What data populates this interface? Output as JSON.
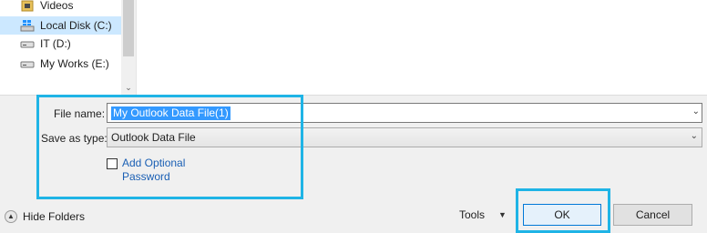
{
  "nav_tree": {
    "items": [
      {
        "label": "Videos",
        "icon": "videos-folder-icon"
      },
      {
        "label": "Local Disk (C:)",
        "icon": "windows-drive-icon"
      },
      {
        "label": "IT (D:)",
        "icon": "drive-icon"
      },
      {
        "label": "My Works (E:)",
        "icon": "drive-icon"
      }
    ],
    "selected_index": 1
  },
  "form": {
    "file_name_label": "File name:",
    "file_name_value": "My Outlook Data File(1)",
    "save_as_type_label": "Save as type:",
    "save_as_type_value": "Outlook Data File",
    "optional_password_line1": "Add Optional",
    "optional_password_line2": "Password",
    "optional_password_checked": false
  },
  "footer": {
    "hide_folders_label": "Hide Folders",
    "tools_label": "Tools",
    "ok_label": "OK",
    "cancel_label": "Cancel"
  },
  "colors": {
    "highlight_box": "#1fb4e6",
    "selection": "#cce8ff",
    "link_text": "#1a5fb4"
  }
}
